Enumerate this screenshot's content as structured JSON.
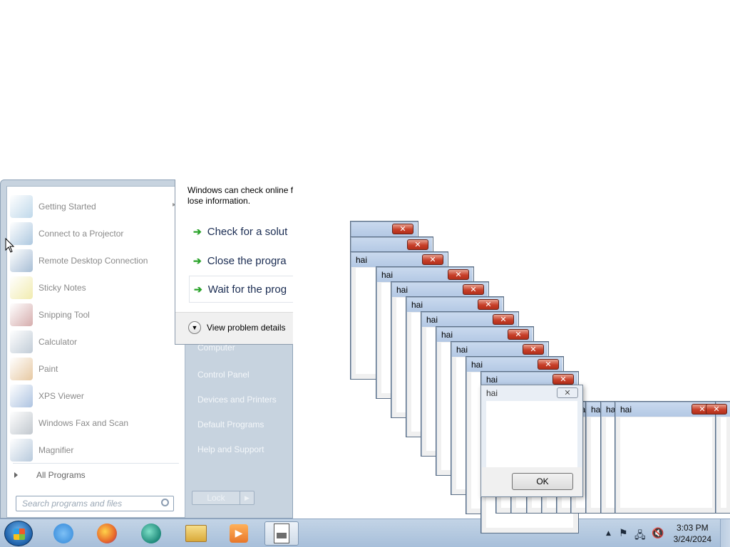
{
  "start_menu": {
    "programs": [
      {
        "label": "Getting Started",
        "icon": "getting-started-icon",
        "color": "#8bb8d9"
      },
      {
        "label": "Connect to a Projector",
        "icon": "projector-icon",
        "color": "#6a9bc6"
      },
      {
        "label": "Remote Desktop Connection",
        "icon": "remote-desktop-icon",
        "color": "#5f88b3"
      },
      {
        "label": "Sticky Notes",
        "icon": "sticky-notes-icon",
        "color": "#e6dc6e"
      },
      {
        "label": "Snipping Tool",
        "icon": "snipping-tool-icon",
        "color": "#b46a6a"
      },
      {
        "label": "Calculator",
        "icon": "calculator-icon",
        "color": "#8ea2b6"
      },
      {
        "label": "Paint",
        "icon": "paint-icon",
        "color": "#d39c57"
      },
      {
        "label": "XPS Viewer",
        "icon": "xps-viewer-icon",
        "color": "#6a92c8"
      },
      {
        "label": "Windows Fax and Scan",
        "icon": "fax-scan-icon",
        "color": "#8e9aa6"
      },
      {
        "label": "Magnifier",
        "icon": "magnifier-icon",
        "color": "#7d9ec0"
      }
    ],
    "all_programs": "All Programs",
    "search_placeholder": "Search programs and files",
    "right_links": [
      "Computer",
      "Control Panel",
      "Devices and Printers",
      "Default Programs",
      "Help and Support"
    ],
    "shutdown_label": "Lock"
  },
  "not_responding_dialog": {
    "intro_line1": "Windows can check online f",
    "intro_line2": "lose information.",
    "options": [
      "Check for a solut",
      "Close the progra",
      "Wait for the prog"
    ],
    "details": "View problem details"
  },
  "dialogs": {
    "title": "hai",
    "close_glyph": "✕",
    "ok_label": "OK"
  },
  "taskbar": {
    "apps": [
      {
        "name": "internet-explorer-icon",
        "color": "#2f86d8"
      },
      {
        "name": "firefox-icon",
        "color": "#e8692a"
      },
      {
        "name": "app-circle-icon",
        "color": "#1f8a7a"
      },
      {
        "name": "file-explorer-icon",
        "color": "#e8c35a"
      },
      {
        "name": "media-player-icon",
        "color": "#e88a2a"
      }
    ],
    "time": "3:03 PM",
    "date": "3/24/2024"
  }
}
